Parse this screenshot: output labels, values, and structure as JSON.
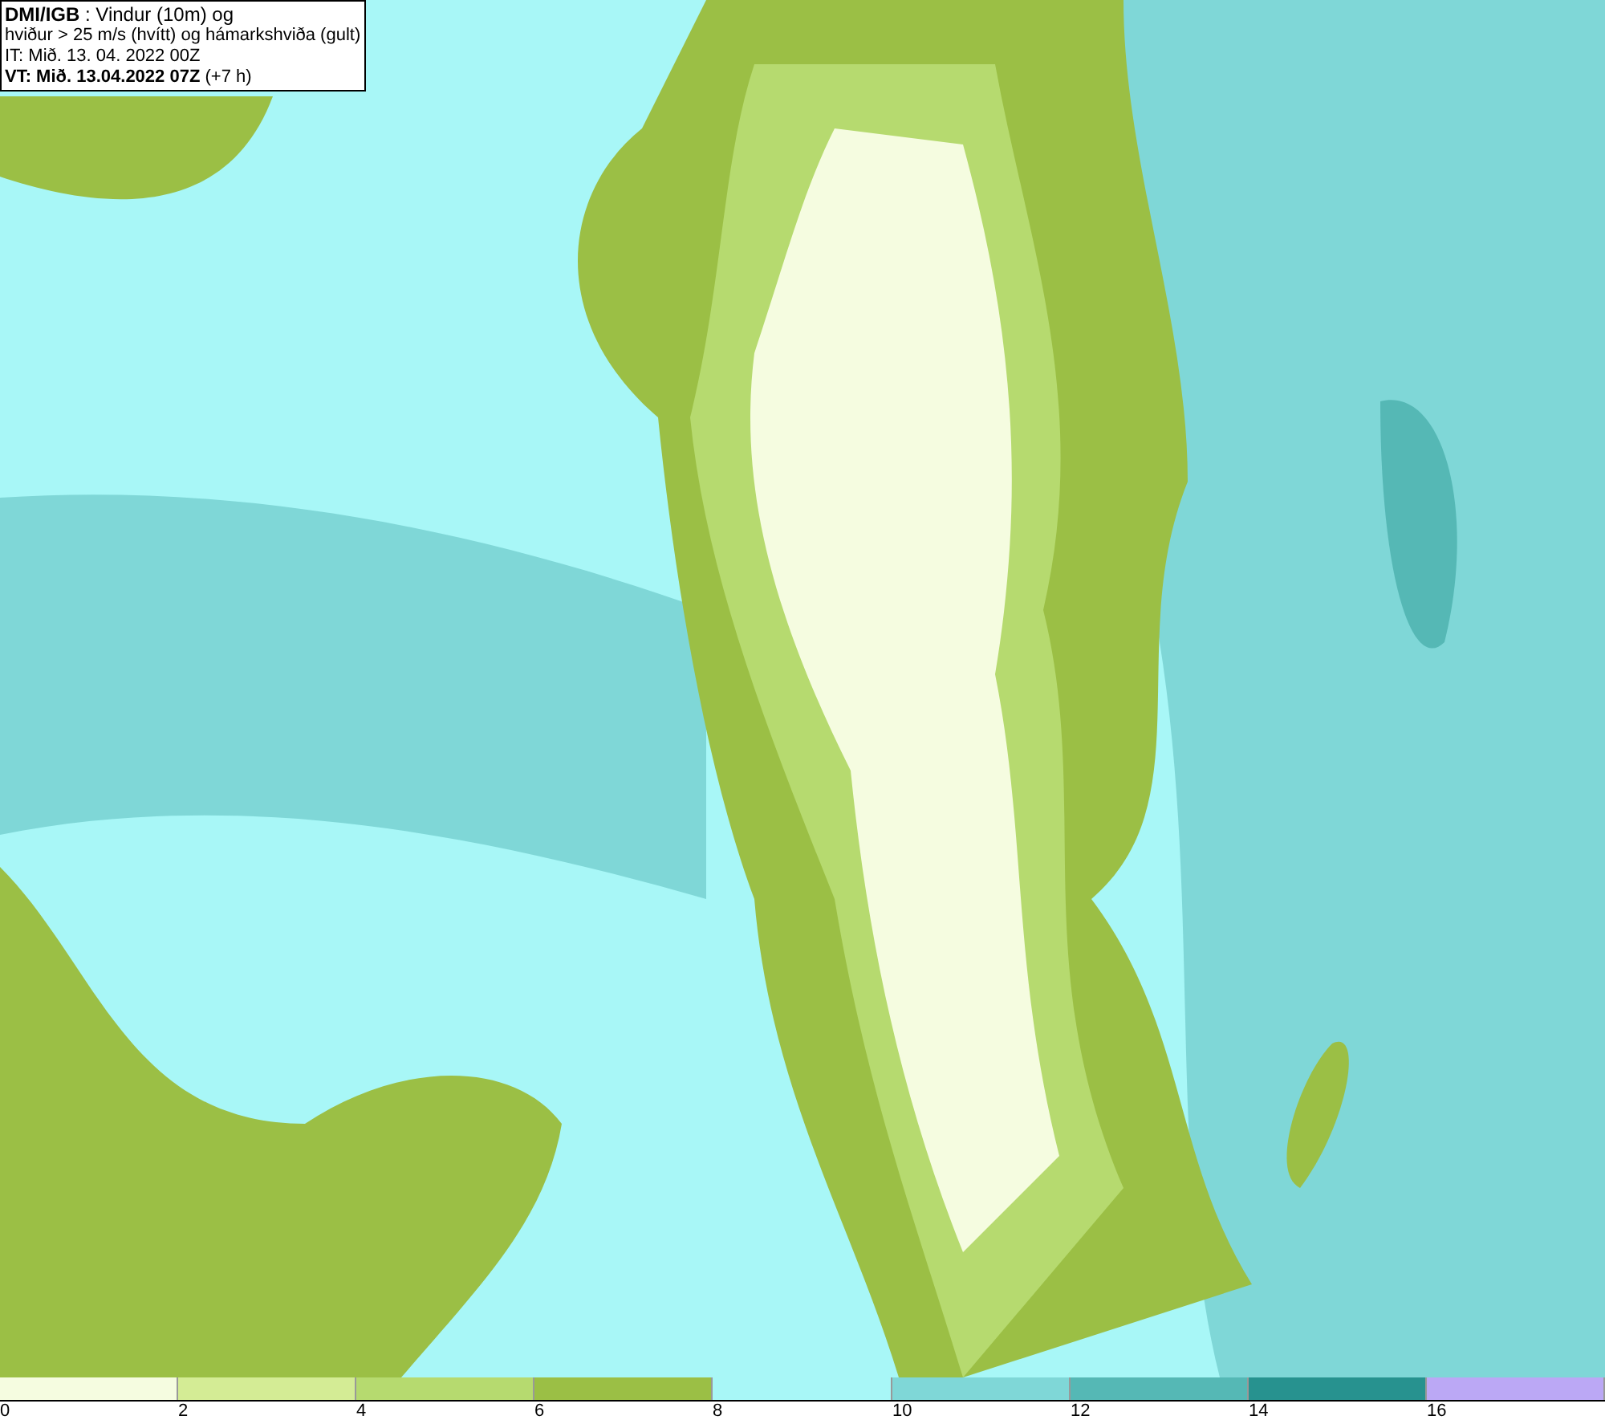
{
  "title_box": {
    "lines": [
      "**DMI/IGB** : Vindur (10m) og",
      "hviður > 25 m/s (hvítt) og hámarkshviða (gult)",
      "IT: Mið. 13. 04. 2022 00Z",
      "**VT: Mið. 13.04.2022 07Z** (+7 h)"
    ]
  },
  "legend": {
    "bins": [
      {
        "color": "#f5fce0",
        "label": "0"
      },
      {
        "color": "#d4ec95",
        "label": "2"
      },
      {
        "color": "#b6da6f",
        "label": "4"
      },
      {
        "color": "#9bbf45",
        "label": "6"
      },
      {
        "color": "#a8f7f7",
        "label": "8"
      },
      {
        "color": "#7fd7d7",
        "label": "10"
      },
      {
        "color": "#55b8b5",
        "label": "12"
      },
      {
        "color": "#27928f",
        "label": "14"
      },
      {
        "color": "#bba8f5",
        "label": "16"
      }
    ]
  }
}
